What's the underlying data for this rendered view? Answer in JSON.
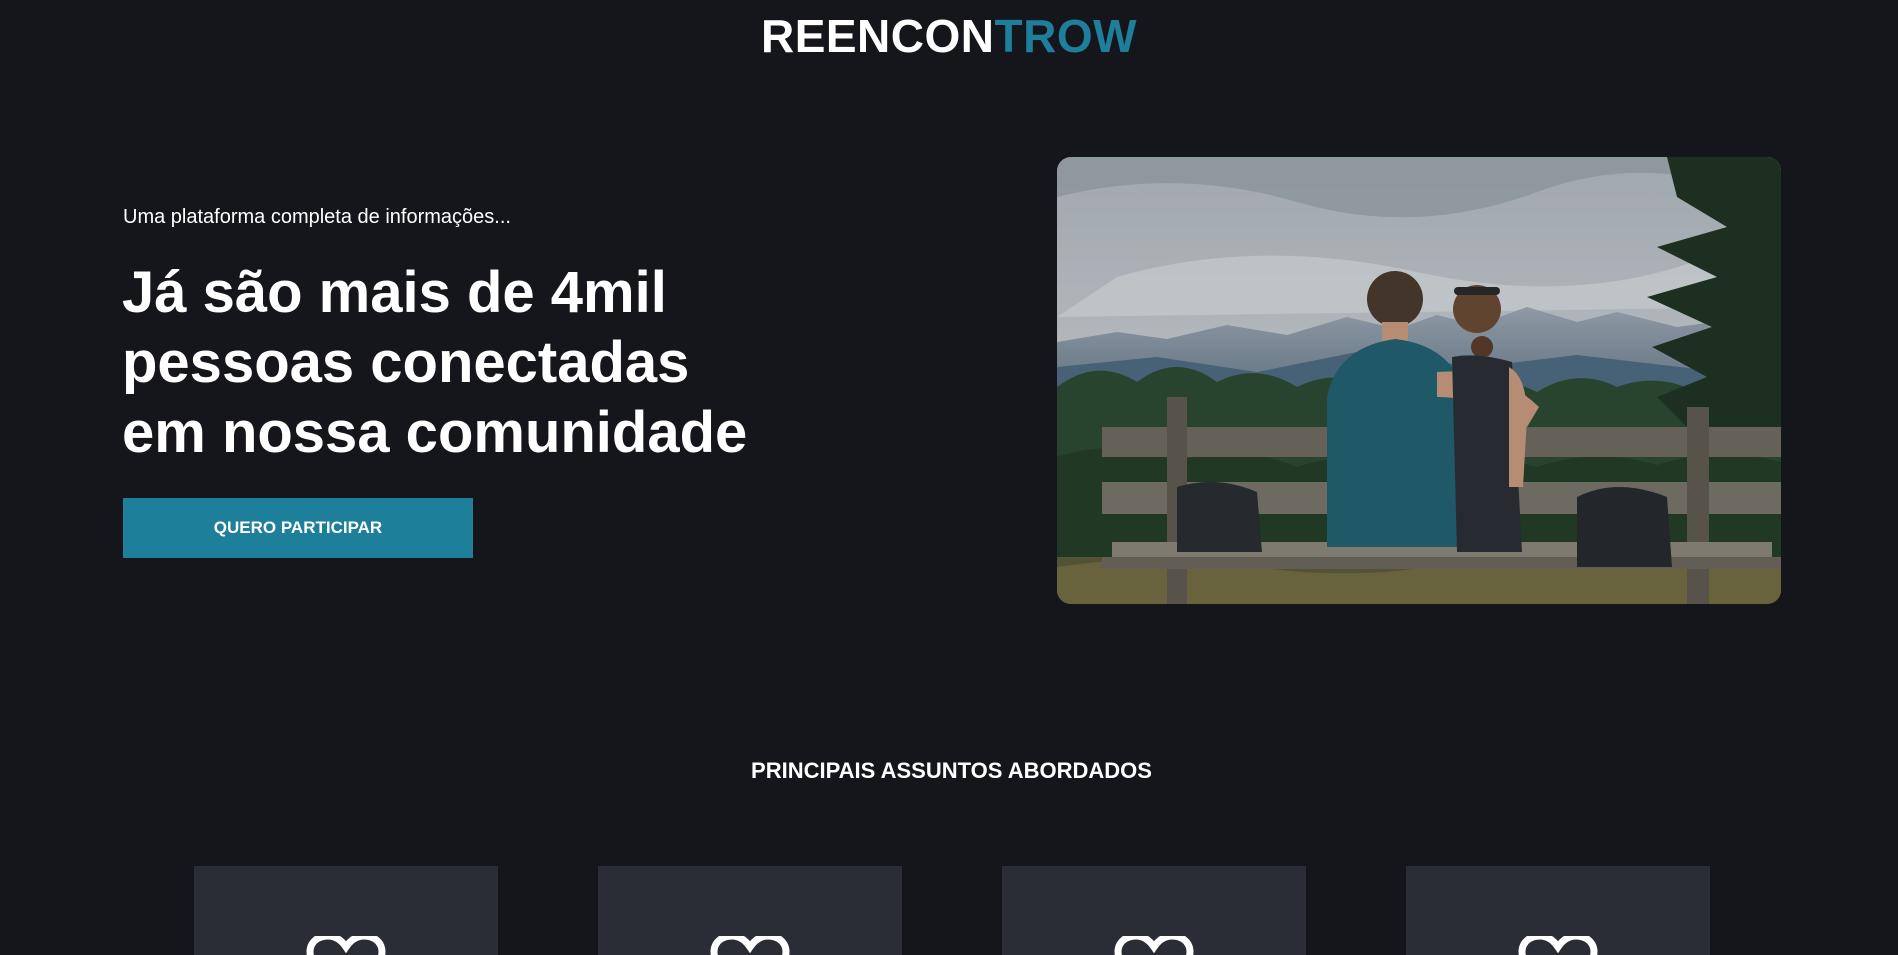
{
  "header": {
    "logo_part_a": "REENCON",
    "logo_part_b": "TROW",
    "accent_color": "#1e7f9b"
  },
  "hero": {
    "tagline": "Uma plataforma completa de informações...",
    "title_lines": [
      "Já são mais de 4mil",
      "pessoas conectadas",
      "em nossa comunidade"
    ],
    "cta_label": "QUERO PARTICIPAR"
  },
  "topics": {
    "title": "PRINCIPAIS ASSUNTOS ABORDADOS",
    "cards": [
      {
        "icon": "heart-icon"
      },
      {
        "icon": "heart-icon"
      },
      {
        "icon": "heart-icon"
      },
      {
        "icon": "heart-icon"
      }
    ]
  }
}
